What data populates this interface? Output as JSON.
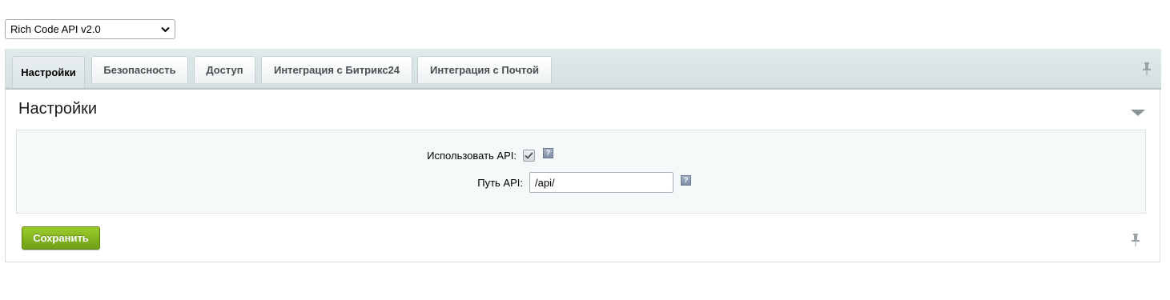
{
  "module_select": {
    "value": "Rich Code API v2.0"
  },
  "tabs": [
    {
      "label": "Настройки",
      "active": true
    },
    {
      "label": "Безопасность",
      "active": false
    },
    {
      "label": "Доступ",
      "active": false
    },
    {
      "label": "Интеграция с Битрикс24",
      "active": false
    },
    {
      "label": "Интеграция с Почтой",
      "active": false
    }
  ],
  "section": {
    "title": "Настройки"
  },
  "form": {
    "use_api": {
      "label": "Использовать API:",
      "checked": true,
      "help": "?"
    },
    "api_path": {
      "label": "Путь API:",
      "value": "/api/",
      "help": "?"
    }
  },
  "actions": {
    "save_label": "Сохранить"
  },
  "icons": {
    "select_chevron": "chevron-down-icon",
    "tab_pin": "pin-icon",
    "collapse": "triangle-down-icon",
    "help": "help-icon",
    "checkbox_check": "checkmark-icon",
    "bottom_pin": "pin-icon"
  },
  "colors": {
    "save_button": "#7fb01c",
    "tab_bar": "#d9e3e5",
    "form_background": "#f5f9f9"
  }
}
